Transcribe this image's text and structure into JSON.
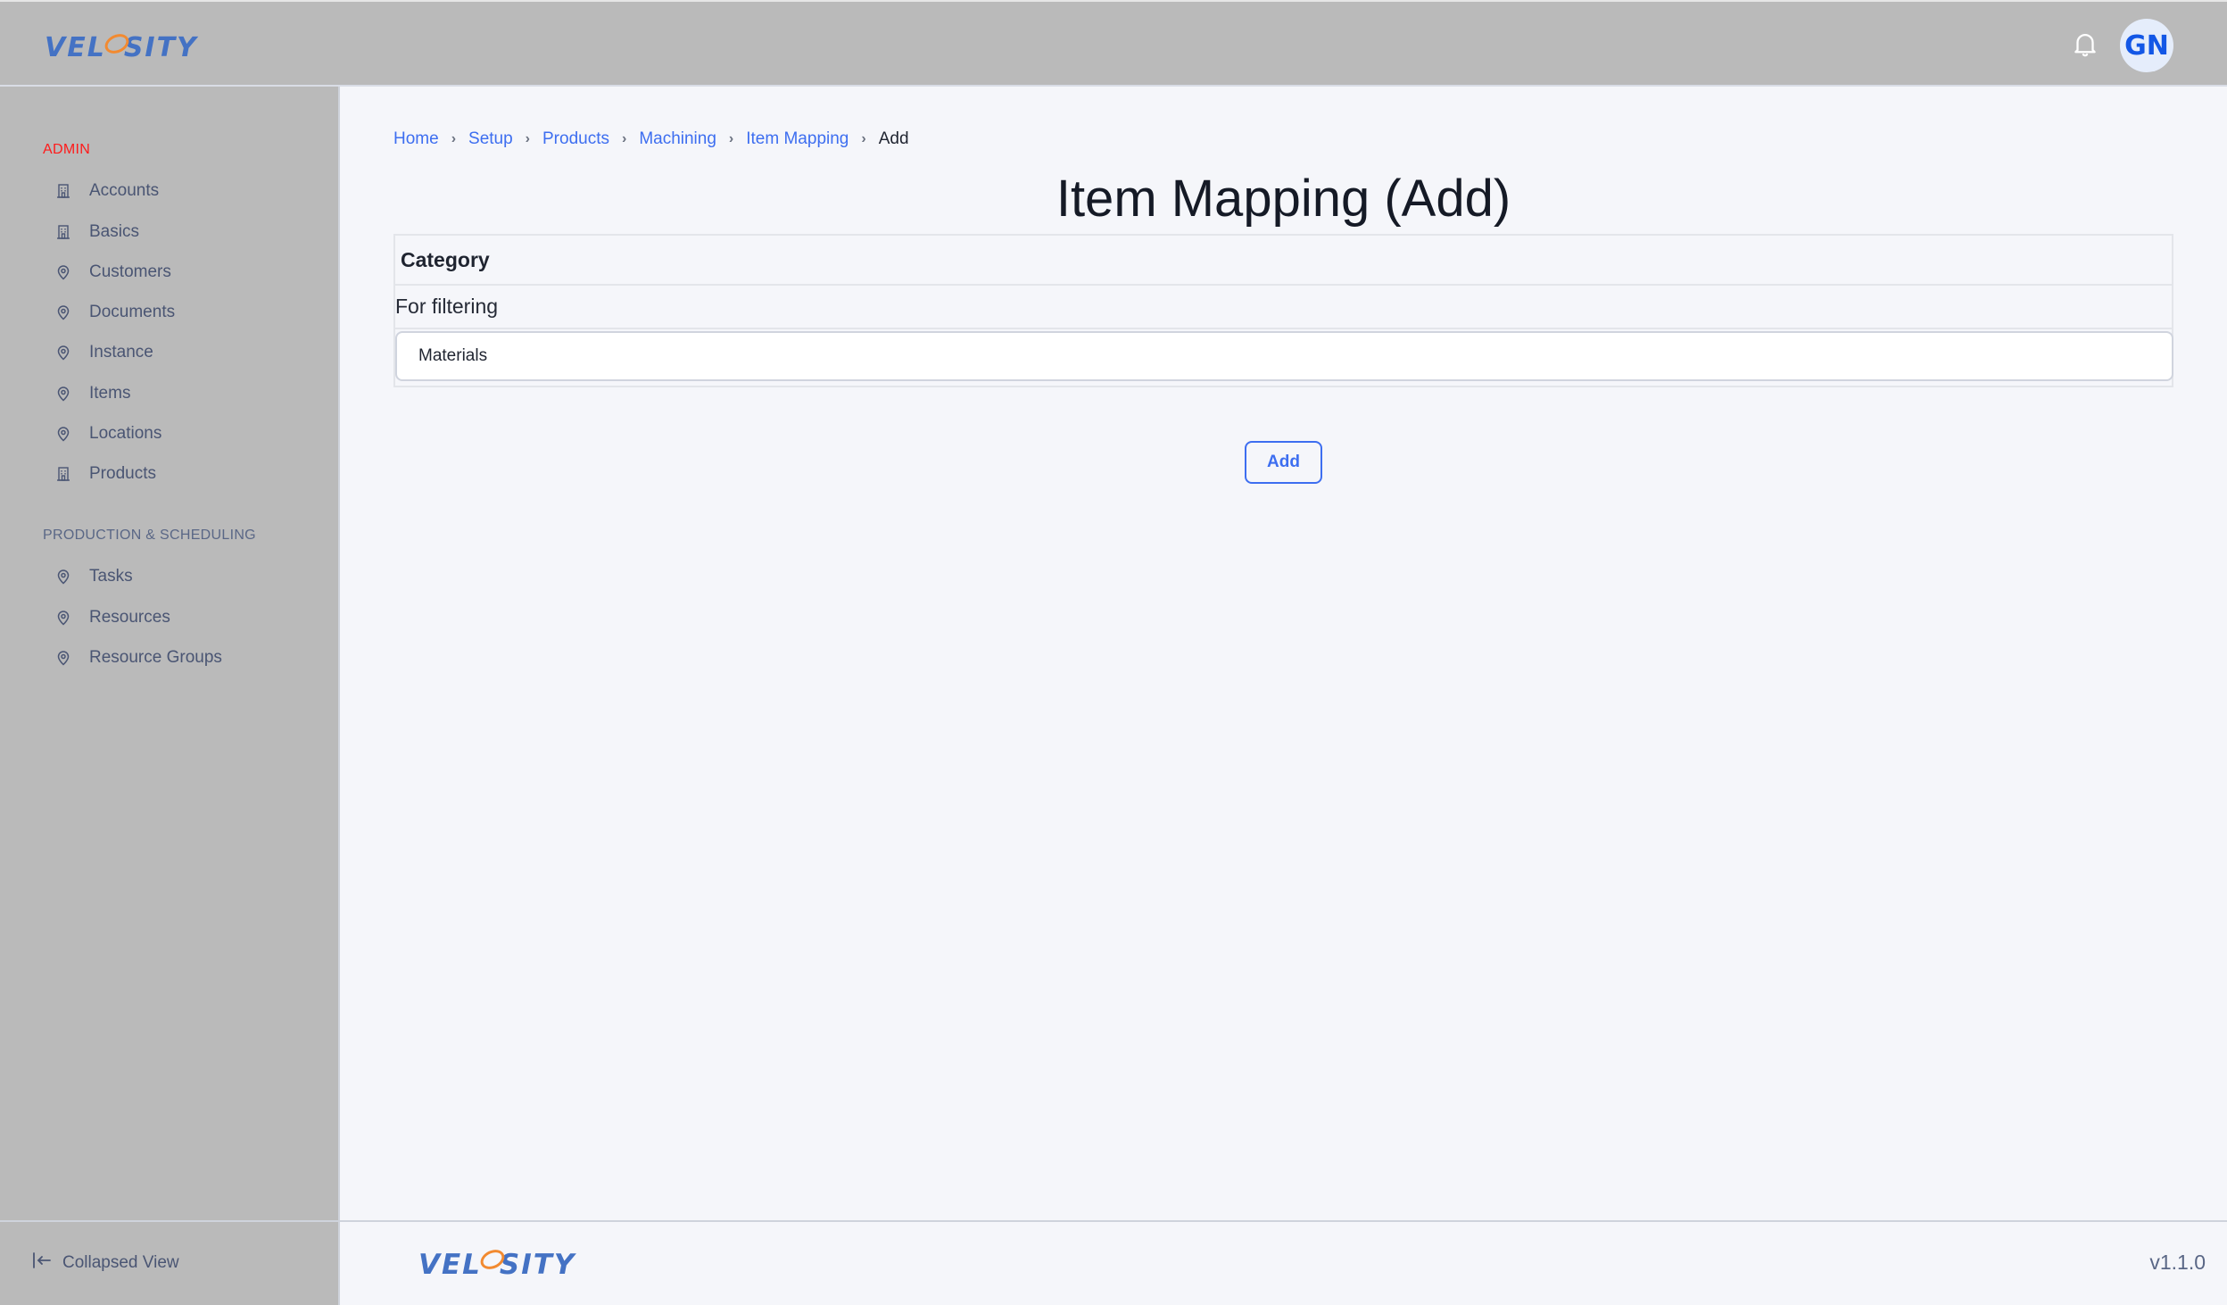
{
  "brand": {
    "logo_parts": [
      "VEL",
      "O",
      "SITY"
    ],
    "primary_color": "#4472c4",
    "accent_color": "#f28a30"
  },
  "header": {
    "notification_icon": "bell-icon",
    "avatar_initials": "GN"
  },
  "sidebar": {
    "sections": [
      {
        "title": "ADMIN",
        "items": [
          {
            "label": "Accounts",
            "icon": "building-icon"
          },
          {
            "label": "Basics",
            "icon": "building-icon"
          },
          {
            "label": "Customers",
            "icon": "map-pin-icon"
          },
          {
            "label": "Documents",
            "icon": "map-pin-icon"
          },
          {
            "label": "Instance",
            "icon": "map-pin-icon"
          },
          {
            "label": "Items",
            "icon": "map-pin-icon"
          },
          {
            "label": "Locations",
            "icon": "map-pin-icon"
          },
          {
            "label": "Products",
            "icon": "building-icon"
          }
        ]
      },
      {
        "title": "PRODUCTION & SCHEDULING",
        "items": [
          {
            "label": "Tasks",
            "icon": "map-pin-icon"
          },
          {
            "label": "Resources",
            "icon": "map-pin-icon"
          },
          {
            "label": "Resource Groups",
            "icon": "map-pin-icon"
          }
        ]
      }
    ],
    "collapse_label": "Collapsed View"
  },
  "breadcrumb": {
    "items": [
      "Home",
      "Setup",
      "Products",
      "Machining",
      "Item Mapping"
    ],
    "current": "Add"
  },
  "page": {
    "title": "Item Mapping (Add)",
    "field": {
      "label": "Category",
      "description": "For filtering",
      "value": "Materials"
    },
    "add_button": "Add"
  },
  "footer": {
    "version": "v1.1.0"
  }
}
